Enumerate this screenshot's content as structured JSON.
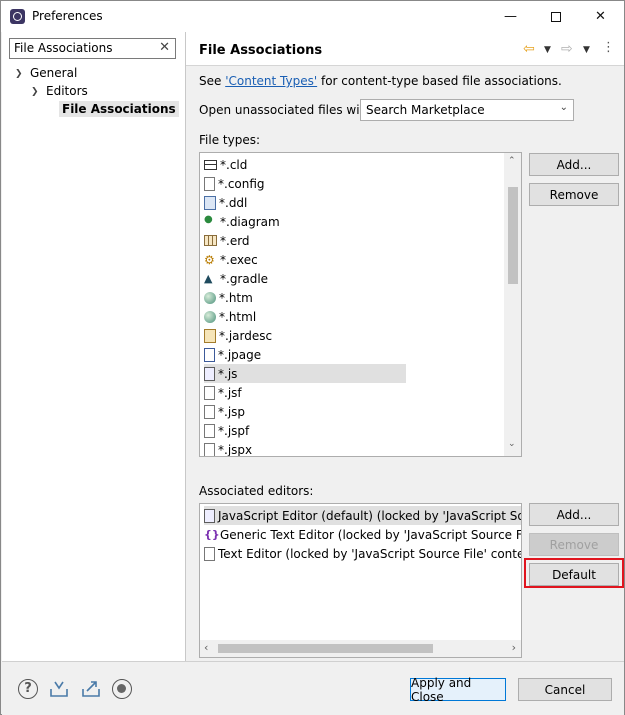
{
  "window": {
    "title": "Preferences",
    "minimize_icon": "minimize-icon",
    "maximize_icon": "maximize-icon",
    "close_icon": "close-icon"
  },
  "sidebar": {
    "filter_value": "File Associations",
    "tree": [
      {
        "label": "General",
        "level": 0,
        "expanded": true
      },
      {
        "label": "Editors",
        "level": 1,
        "expanded": true
      },
      {
        "label": "File Associations",
        "level": 2,
        "selected": true
      }
    ]
  },
  "page": {
    "title": "File Associations",
    "see_prefix": "See ",
    "see_link": "'Content Types'",
    "see_suffix": " for content-type based file associations.",
    "open_unassociated_label": "Open unassociated files with:",
    "open_unassociated_value": "Search Marketplace",
    "file_types_label": "File types:",
    "file_types": [
      {
        "name": "*.cld",
        "icon": "table-icon"
      },
      {
        "name": "*.config",
        "icon": "file-icon"
      },
      {
        "name": "*.ddl",
        "icon": "ddl-icon"
      },
      {
        "name": "*.diagram",
        "icon": "diagram-icon"
      },
      {
        "name": "*.erd",
        "icon": "erd-icon"
      },
      {
        "name": "*.exec",
        "icon": "gears-icon"
      },
      {
        "name": "*.gradle",
        "icon": "gradle-icon"
      },
      {
        "name": "*.htm",
        "icon": "globe-icon"
      },
      {
        "name": "*.html",
        "icon": "globe-icon"
      },
      {
        "name": "*.jardesc",
        "icon": "jardesc-icon"
      },
      {
        "name": "*.jpage",
        "icon": "jpage-icon"
      },
      {
        "name": "*.js",
        "icon": "js-file-icon",
        "selected": true
      },
      {
        "name": "*.jsf",
        "icon": "file-icon"
      },
      {
        "name": "*.jsp",
        "icon": "file-icon"
      },
      {
        "name": "*.jspf",
        "icon": "file-icon"
      },
      {
        "name": "*.jspx",
        "icon": "file-icon"
      }
    ],
    "file_types_add": "Add...",
    "file_types_remove": "Remove",
    "associated_editors_label": "Associated editors:",
    "associated_editors": [
      {
        "name": "JavaScript Editor (default) (locked by 'JavaScript Source",
        "icon": "js-editor-icon",
        "selected": true
      },
      {
        "name": "Generic Text Editor (locked by 'JavaScript Source File' c",
        "icon": "generic-editor-icon"
      },
      {
        "name": "Text Editor (locked by 'JavaScript Source File' content ty",
        "icon": "text-editor-icon"
      }
    ],
    "editors_add": "Add...",
    "editors_remove": "Remove",
    "editors_default": "Default"
  },
  "footer": {
    "apply_close": "Apply and Close",
    "cancel": "Cancel"
  },
  "colors": {
    "highlight": "#e0141e",
    "link": "#1a5fb4",
    "focus": "#0078d7"
  }
}
